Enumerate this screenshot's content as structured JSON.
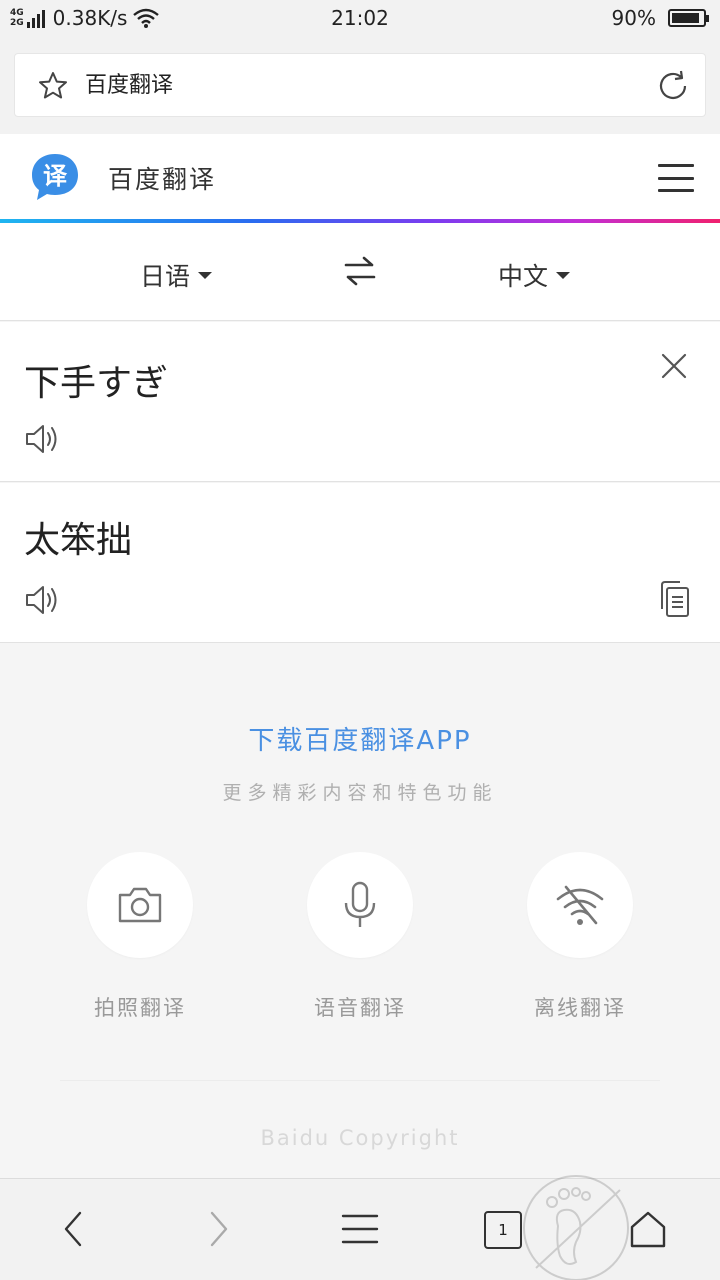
{
  "status_bar": {
    "network_top": "4G",
    "network_bottom": "2G",
    "speed": "0.38K/s",
    "time": "21:02",
    "battery": "90%",
    "battery_level": 0.9
  },
  "browser": {
    "page_title": "百度翻译",
    "star_icon": "star-icon",
    "refresh_icon": "refresh-icon"
  },
  "site": {
    "logo_char": "译",
    "title": "百度翻译",
    "brand_color": "#3a8ee6"
  },
  "languages": {
    "source": "日语",
    "target": "中文"
  },
  "translation": {
    "source_text": "下手すぎ",
    "result_text": "太笨拙"
  },
  "promo": {
    "title": "下载百度翻译APP",
    "subtitle": "更多精彩内容和特色功能"
  },
  "features": [
    {
      "label": "拍照翻译",
      "icon": "camera-icon"
    },
    {
      "label": "语音翻译",
      "icon": "microphone-icon"
    },
    {
      "label": "离线翻译",
      "icon": "wifi-off-icon"
    }
  ],
  "footer": {
    "copyright": "Baidu Copyright"
  },
  "bottom_nav": {
    "tab_count": "1"
  }
}
